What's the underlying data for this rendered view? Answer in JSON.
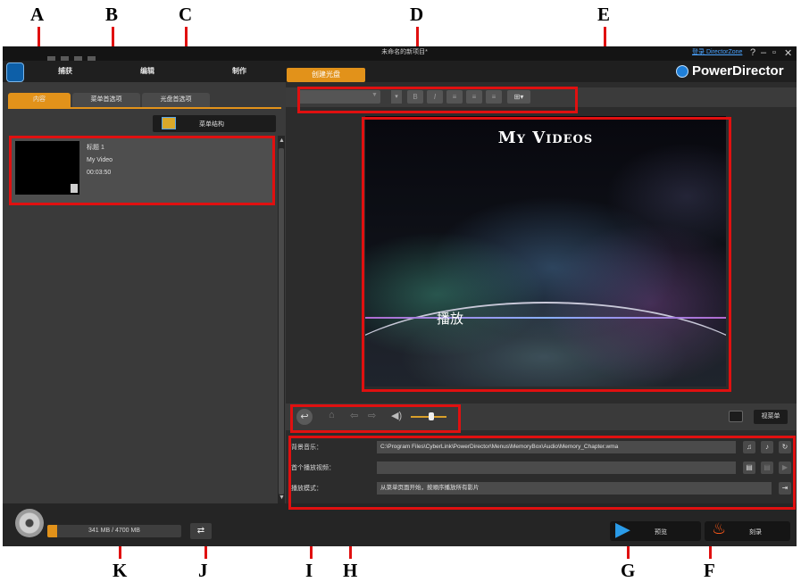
{
  "window": {
    "title": "未命名的新项目*",
    "login_link": "登录 DirectorZone",
    "help": "?",
    "minimize": "–",
    "restore": "▫",
    "close": "✕"
  },
  "brand": {
    "name": "PowerDirector"
  },
  "main_nav": {
    "tabs": [
      {
        "label": "捕获"
      },
      {
        "label": "编辑"
      },
      {
        "label": "制作"
      },
      {
        "label": "创建光盘"
      }
    ]
  },
  "left_panel": {
    "tabs": [
      {
        "label": "内容"
      },
      {
        "label": "菜单首选项"
      },
      {
        "label": "光盘首选项"
      }
    ],
    "menu_structure_label": "菜单结构",
    "title_item": {
      "name": "标题 1",
      "video": "My Video",
      "duration": "00:03:50"
    }
  },
  "preview": {
    "title": "My Videos",
    "play_label": "播放"
  },
  "view_menu_label": "视菜单",
  "settings": {
    "bg_music_label": "背景音乐：",
    "bg_music_value": "C:\\Program Files\\CyberLink\\PowerDirector\\Menus\\MemoryBox\\Audio\\Memory_Chapter.wma",
    "first_play_label": "首个播放视频：",
    "first_play_value": "",
    "playback_mode_label": "播放模式：",
    "playback_mode_value": "从菜单页面开始，按顺序播放所有影片"
  },
  "bottom": {
    "capacity_text": "341 MB / 4700 MB",
    "capacity_fraction": 0.073,
    "preview_label": "预览",
    "burn_label": "刻录"
  },
  "callouts": {
    "A": "A",
    "B": "B",
    "C": "C",
    "D": "D",
    "E": "E",
    "F": "F",
    "G": "G",
    "H": "H",
    "I": "I",
    "J": "J",
    "K": "K"
  },
  "colors": {
    "accent": "#e2921a",
    "annotation": "#e01010",
    "link": "#4aa3ff"
  }
}
